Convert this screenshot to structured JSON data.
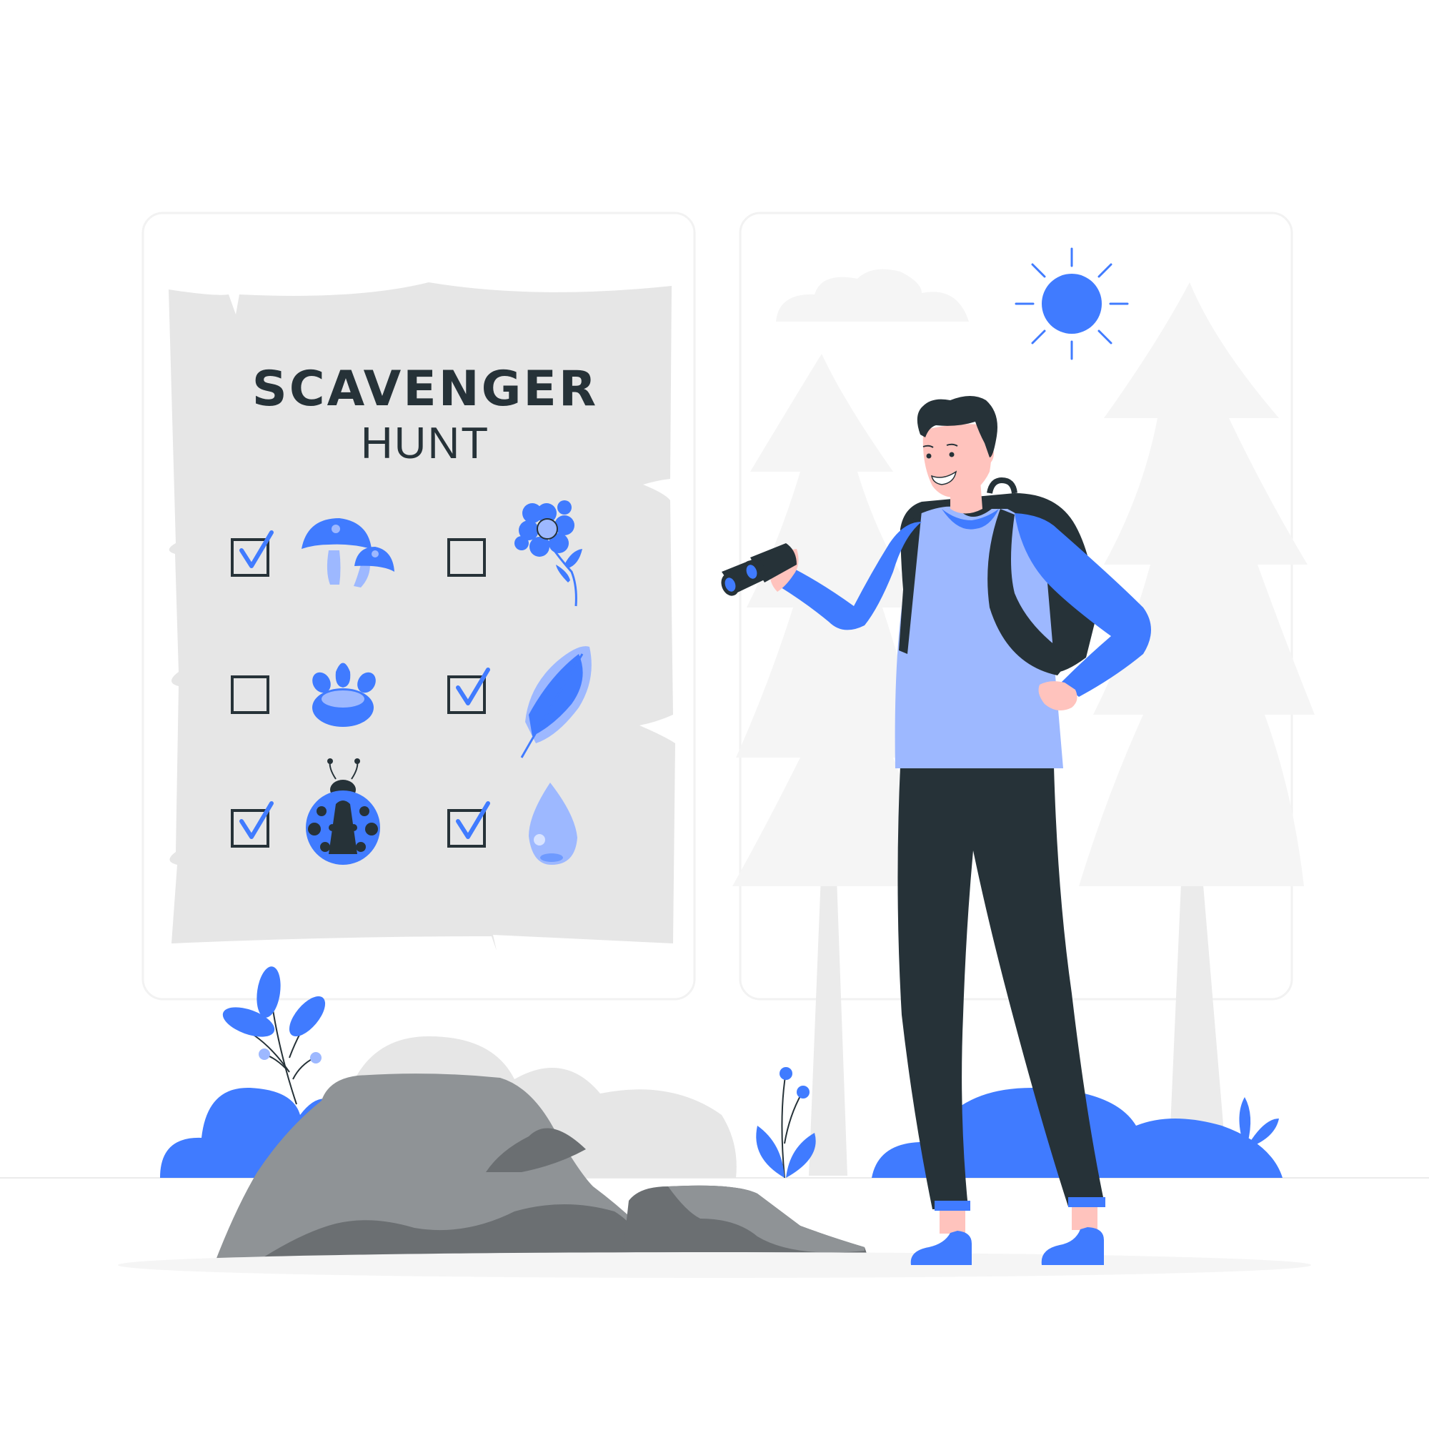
{
  "poster": {
    "title": "SCAVENGER",
    "subtitle": "HUNT"
  },
  "checklist": [
    {
      "item": "mushroom-icon",
      "checked": true
    },
    {
      "item": "flower-icon",
      "checked": false
    },
    {
      "item": "paw-print-icon",
      "checked": false
    },
    {
      "item": "feather-icon",
      "checked": true
    },
    {
      "item": "ladybug-icon",
      "checked": true
    },
    {
      "item": "water-drop-icon",
      "checked": true
    }
  ],
  "colors": {
    "accent": "#407BFF",
    "accent_light": "#9DB8FF",
    "dark": "#263238",
    "paper": "#E6E6E6",
    "rock_light": "#8F9396",
    "rock_dark": "#6B6F72",
    "tree": "#F5F5F5",
    "skin": "#FFC3BD"
  }
}
